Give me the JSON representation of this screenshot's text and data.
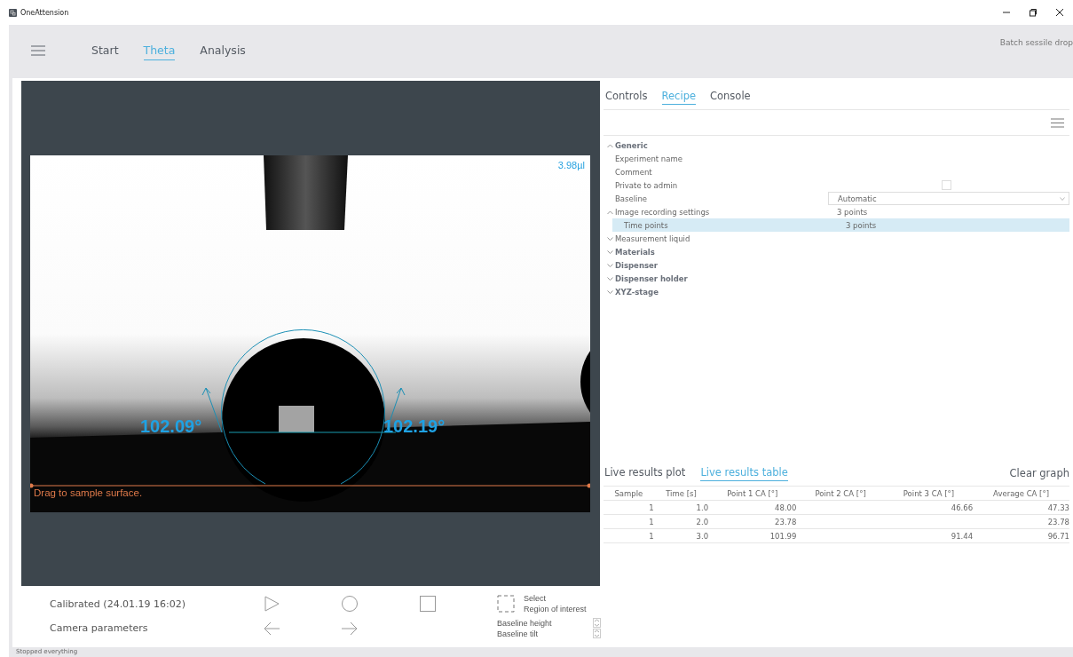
{
  "window": {
    "title": "OneAttension"
  },
  "nav": {
    "tabs": [
      {
        "label": "Start",
        "selected": false
      },
      {
        "label": "Theta",
        "selected": true
      },
      {
        "label": "Analysis",
        "selected": false
      }
    ],
    "mode": "Batch sessile drop"
  },
  "camera": {
    "volume": "3.98µl",
    "left_angle": "102.09°",
    "right_angle": "102.19°",
    "hint": "Drag to sample surface."
  },
  "camera_controls": {
    "calibration": "Calibrated (24.01.19 16:02)",
    "camera_parameters": "Camera parameters",
    "select_lines": [
      "Select",
      "Region of interest"
    ],
    "baseline_height": "Baseline height",
    "baseline_tilt": "Baseline tilt"
  },
  "side_tabs": [
    {
      "label": "Controls",
      "selected": false
    },
    {
      "label": "Recipe",
      "selected": true
    },
    {
      "label": "Console",
      "selected": false
    }
  ],
  "recipe": [
    {
      "label": "Generic",
      "kind": "group",
      "expanded": true,
      "selected": false,
      "children": [
        {
          "label": "Experiment name",
          "kind": "text",
          "selected": false
        },
        {
          "label": "Comment",
          "kind": "text",
          "selected": false
        },
        {
          "label": "Private to admin",
          "kind": "checkbox",
          "checked": false,
          "selected": false
        },
        {
          "label": "Baseline",
          "kind": "dropdown",
          "value": "Automatic",
          "selected": false
        },
        {
          "label": "Image recording settings",
          "kind": "group",
          "expanded": true,
          "value": "3 points",
          "selected": false,
          "children": [
            {
              "label": "Time points",
              "kind": "text",
              "value": "3 points",
              "selected": true
            }
          ]
        },
        {
          "label": "Measurement liquid",
          "kind": "group",
          "expanded": false,
          "selected": false
        }
      ]
    },
    {
      "label": "Materials",
      "kind": "group",
      "expanded": false,
      "selected": false
    },
    {
      "label": "Dispenser",
      "kind": "group",
      "expanded": false,
      "selected": false
    },
    {
      "label": "Dispenser holder",
      "kind": "group",
      "expanded": false,
      "selected": false
    },
    {
      "label": "XYZ-stage",
      "kind": "group",
      "expanded": false,
      "selected": false
    }
  ],
  "results": {
    "tabs": [
      {
        "label": "Live results plot",
        "selected": false
      },
      {
        "label": "Live results table",
        "selected": true
      }
    ],
    "clear": "Clear graph",
    "columns": [
      "Sample",
      "Time [s]",
      "Point 1 CA [°]",
      "Point 2 CA [°]",
      "Point 3 CA [°]",
      "Average CA [°]"
    ],
    "rows": [
      [
        "1",
        "1.0",
        "48.00",
        "",
        "46.66",
        "47.33"
      ],
      [
        "1",
        "2.0",
        "23.78",
        "",
        "",
        "23.78"
      ],
      [
        "1",
        "3.0",
        "101.99",
        "",
        "91.44",
        "96.71"
      ]
    ]
  },
  "status_bar": "Stopped everything"
}
